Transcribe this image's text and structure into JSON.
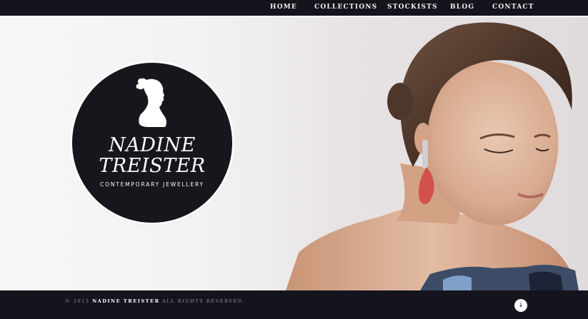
{
  "nav": {
    "items": [
      {
        "label": "HOME"
      },
      {
        "label": "COLLECTIONS"
      },
      {
        "label": "STOCKISTS"
      },
      {
        "label": "BLOG"
      },
      {
        "label": "CONTACT"
      }
    ]
  },
  "logo": {
    "name_line1": "NADINE",
    "name_line2": "TREISTER",
    "tagline": "CONTEMPORARY JEWELLERY",
    "cameo_icon": "woman-silhouette-icon"
  },
  "hero": {
    "image": "model-wearing-red-drop-earring"
  },
  "footer": {
    "copyright_prefix": "© 2013",
    "brand": "NADINE TREISTER",
    "rights": "ALL RIGHTS RESERVED.",
    "scroll_icon": "arrow-down-icon",
    "scroll_glyph": "↓"
  },
  "colors": {
    "bar": "#14141c",
    "logo_bg": "#16161c",
    "earring": "#d2514a",
    "text_light": "#f2f2f2"
  }
}
